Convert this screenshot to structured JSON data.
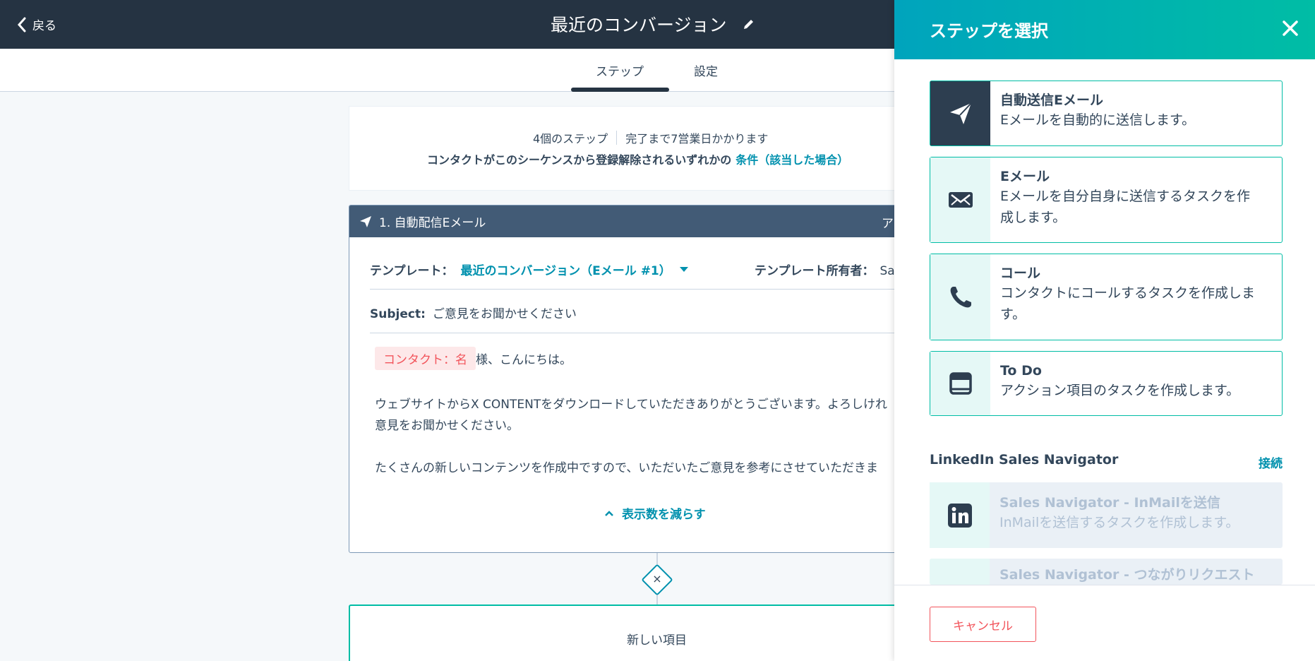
{
  "header": {
    "back_label": "戻る",
    "sequence_title": "最近のコンバージョン"
  },
  "tabs": [
    {
      "label": "ステップ",
      "active": true
    },
    {
      "label": "設定",
      "active": false
    }
  ],
  "summary": {
    "step_count": "4個のステップ",
    "duration": "完了まで7営業日かかります",
    "unenroll_text": "コンタクトがこのシーケンスから登録解除されるいずれかの",
    "unenroll_link": "条件（該当した場合）"
  },
  "step1": {
    "header": "1. 自動配信Eメール",
    "header_right": "ア",
    "template_label": "テンプレート：",
    "template_value": "最近のコンバージョン（Eメール #1）",
    "owner_label": "テンプレート所有者：",
    "owner_value": "Sa",
    "subject_label": "Subject:",
    "subject_value": "ご意見をお聞かせください",
    "token": "コンタクト：名",
    "greeting": "様、こんにちは。",
    "body_line1": "ウェブサイトからX CONTENTをダウンロードしていただきありがとうございます。よろしけれ",
    "body_line2": "意見をお聞かせください。",
    "body_line3": "たくさんの新しいコンテンツを作成中ですので、いただいたご意見を参考にさせていただきま",
    "show_less": "表示数を減らす"
  },
  "new_item": {
    "label": "新しい項目"
  },
  "panel": {
    "title": "ステップを選択",
    "options": [
      {
        "title": "自動送信Eメール",
        "desc": "Eメールを自動的に送信します。",
        "icon": "paper-plane-icon"
      },
      {
        "title": "Eメール",
        "desc1": "Eメールを自分自身に送信するタスクを作",
        "desc2": "成します。",
        "icon": "envelope-icon"
      },
      {
        "title": "コール",
        "desc1": "コンタクトにコールするタスクを作成しま",
        "desc2": "す。",
        "icon": "phone-icon"
      },
      {
        "title": "To Do",
        "desc": "アクション項目のタスクを作成します。",
        "icon": "todo-icon"
      }
    ],
    "linkedin_heading": "LinkedIn Sales Navigator",
    "linkedin_connect": "接続",
    "linkedin_options": [
      {
        "title": "Sales Navigator - InMailを送信",
        "desc": "InMailを送信するタスクを作成します。"
      },
      {
        "title": "Sales Navigator - つながりリクエスト"
      }
    ],
    "cancel_label": "キャンセル"
  },
  "colors": {
    "topbar": "#253342",
    "accent": "#0091ae",
    "teal": "#00bda5",
    "danger": "#f2545b"
  }
}
